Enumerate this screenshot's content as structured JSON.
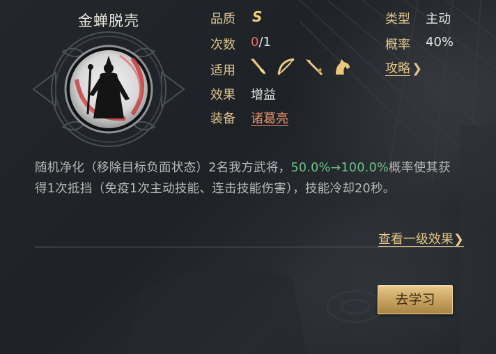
{
  "skill": {
    "name": "金蝉脱壳"
  },
  "info": {
    "quality_label": "品质",
    "quality_value": "S",
    "count_label": "次数",
    "count_used": "0",
    "count_total": "/1",
    "applies_label": "适用",
    "applies_icons": [
      "sword-icon",
      "bow-icon",
      "spear-icon",
      "horse-icon"
    ],
    "effect_label": "效果",
    "effect_value": "增益",
    "equip_label": "装备",
    "equip_value": "诸葛亮",
    "type_label": "类型",
    "type_value": "主动",
    "chance_label": "概率",
    "chance_value": "40%",
    "strategy_label": "攻略",
    "strategy_chevron": "❯"
  },
  "description": {
    "part1": "随机净化（移除目标负面状态）2名我方武将，",
    "highlight": "50.0%→100.0%",
    "part2": "概率使其获得1次抵挡（免疫1次主动技能、连击技能伤害），技能冷却20秒。"
  },
  "footer": {
    "view_more": "查看一级效果",
    "view_more_chevron": "❯",
    "learn_button": "去学习"
  },
  "colors": {
    "label": "#dcc48e",
    "grade": "#f2d27a",
    "count_used": "#e26b6b",
    "equip_link": "#e7936b",
    "highlight": "#6dc389",
    "button": "#c9a461"
  }
}
